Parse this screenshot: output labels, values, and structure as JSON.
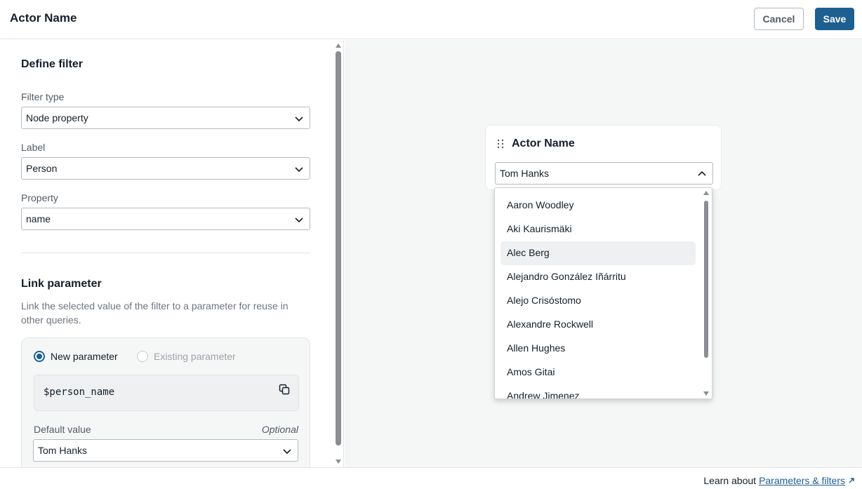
{
  "header": {
    "title": "Actor Name",
    "cancel_label": "Cancel",
    "save_label": "Save"
  },
  "define_filter": {
    "title": "Define filter",
    "filter_type": {
      "label": "Filter type",
      "value": "Node property"
    },
    "label_field": {
      "label": "Label",
      "value": "Person"
    },
    "property_field": {
      "label": "Property",
      "value": "name"
    }
  },
  "link_parameter": {
    "title": "Link parameter",
    "description": "Link the selected value of the filter to a parameter for reuse in other queries.",
    "new_parameter_label": "New parameter",
    "existing_parameter_label": "Existing parameter",
    "parameter_name": "$person_name",
    "default_value_label": "Default value",
    "optional_label": "Optional",
    "default_value": "Tom Hanks"
  },
  "preview": {
    "card_title": "Actor Name",
    "selected_value": "Tom Hanks",
    "options": [
      "Aaron Woodley",
      "Aki Kaurismäki",
      "Alec Berg",
      "Alejandro González Iñárritu",
      "Alejo Crisóstomo",
      "Alexandre Rockwell",
      "Allen Hughes",
      "Amos Gitai",
      "Andrew Jimenez"
    ],
    "highlighted_option": "Alec Berg"
  },
  "footer": {
    "learn_text": "Learn about",
    "link_text": "Parameters & filters"
  },
  "colors": {
    "primary": "#1e5f91",
    "canvas_bg": "#f5f6f6",
    "text": "#151e29"
  }
}
